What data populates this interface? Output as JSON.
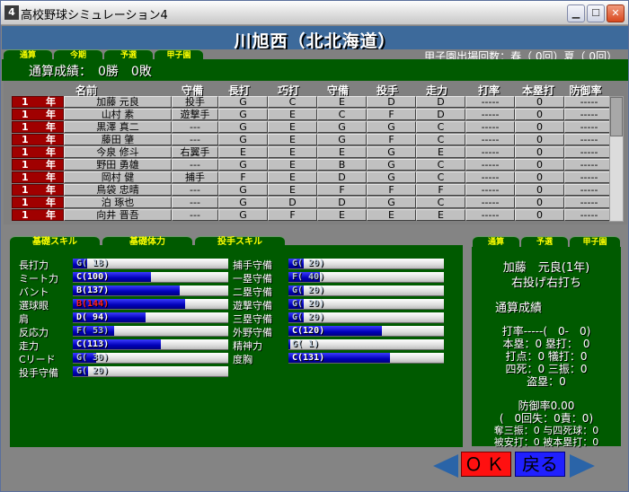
{
  "window": {
    "title": "高校野球シミュレーション4",
    "app_icon": "4",
    "buttons": {
      "minimize": "▁",
      "maximize": "☐",
      "close": "✕"
    }
  },
  "header": {
    "school_name": "川旭西（北北海道）",
    "appearances": "甲子園出場回数：春（ 0回）夏（ 0回）"
  },
  "top_tabs": [
    "通算",
    "今期",
    "予選",
    "甲子園"
  ],
  "record": {
    "label": "通算成績：　0勝　0敗"
  },
  "table": {
    "headers": [
      "名前",
      "守備",
      "長打",
      "巧打",
      "守備",
      "投手",
      "走力",
      "打率",
      "本塁打",
      "防御率"
    ],
    "rows": [
      {
        "grade_n": "1",
        "grade_y": "年",
        "name": "加藤 元良",
        "pos": "投手",
        "power": "G",
        "contact": "C",
        "field": "E",
        "pitch": "D",
        "speed": "D",
        "avg": "-----",
        "hr": "0",
        "era": "-----"
      },
      {
        "grade_n": "1",
        "grade_y": "年",
        "name": "山村 素",
        "pos": "遊撃手",
        "power": "G",
        "contact": "E",
        "field": "C",
        "pitch": "F",
        "speed": "D",
        "avg": "-----",
        "hr": "0",
        "era": "-----"
      },
      {
        "grade_n": "1",
        "grade_y": "年",
        "name": "黒澤 真二",
        "pos": "---",
        "power": "G",
        "contact": "E",
        "field": "G",
        "pitch": "G",
        "speed": "C",
        "avg": "-----",
        "hr": "0",
        "era": "-----"
      },
      {
        "grade_n": "1",
        "grade_y": "年",
        "name": "藤田 肇",
        "pos": "---",
        "power": "G",
        "contact": "E",
        "field": "G",
        "pitch": "F",
        "speed": "C",
        "avg": "-----",
        "hr": "0",
        "era": "-----"
      },
      {
        "grade_n": "1",
        "grade_y": "年",
        "name": "今泉 修斗",
        "pos": "右翼手",
        "power": "E",
        "contact": "E",
        "field": "E",
        "pitch": "G",
        "speed": "E",
        "avg": "-----",
        "hr": "0",
        "era": "-----"
      },
      {
        "grade_n": "1",
        "grade_y": "年",
        "name": "野田 勇雄",
        "pos": "---",
        "power": "G",
        "contact": "E",
        "field": "B",
        "pitch": "G",
        "speed": "C",
        "avg": "-----",
        "hr": "0",
        "era": "-----"
      },
      {
        "grade_n": "1",
        "grade_y": "年",
        "name": "岡村 健",
        "pos": "捕手",
        "power": "F",
        "contact": "E",
        "field": "D",
        "pitch": "G",
        "speed": "C",
        "avg": "-----",
        "hr": "0",
        "era": "-----"
      },
      {
        "grade_n": "1",
        "grade_y": "年",
        "name": "鳥袋 忠晴",
        "pos": "---",
        "power": "G",
        "contact": "E",
        "field": "F",
        "pitch": "F",
        "speed": "F",
        "avg": "-----",
        "hr": "0",
        "era": "-----"
      },
      {
        "grade_n": "1",
        "grade_y": "年",
        "name": "泊 琢也",
        "pos": "---",
        "power": "G",
        "contact": "D",
        "field": "D",
        "pitch": "G",
        "speed": "C",
        "avg": "-----",
        "hr": "0",
        "era": "-----"
      },
      {
        "grade_n": "1",
        "grade_y": "年",
        "name": "向井 晋吾",
        "pos": "---",
        "power": "G",
        "contact": "F",
        "field": "E",
        "pitch": "E",
        "speed": "E",
        "avg": "-----",
        "hr": "0",
        "era": "-----"
      }
    ]
  },
  "skill_tabs": [
    "基礎スキル",
    "基礎体力",
    "投手スキル"
  ],
  "skills_left": [
    {
      "label": "長打力",
      "text": "G( 18)",
      "value": 18,
      "style": "dim"
    },
    {
      "label": "ミート力",
      "text": "C(100)",
      "value": 100,
      "style": "normal"
    },
    {
      "label": "バント",
      "text": "B(137)",
      "value": 137,
      "style": "normal"
    },
    {
      "label": "選球眼",
      "text": "B(144)",
      "value": 144,
      "style": "red"
    },
    {
      "label": "肩",
      "text": "D( 94)",
      "value": 94,
      "style": "normal"
    },
    {
      "label": "反応力",
      "text": "F( 53)",
      "value": 53,
      "style": "dim"
    },
    {
      "label": "走力",
      "text": "C(113)",
      "value": 113,
      "style": "normal"
    },
    {
      "label": "Cリード",
      "text": "G( 30)",
      "value": 30,
      "style": "dim"
    },
    {
      "label": "投手守備",
      "text": "G( 20)",
      "value": 20,
      "style": "dim"
    }
  ],
  "skills_right": [
    {
      "label": "捕手守備",
      "text": "G( 20)",
      "value": 20,
      "style": "dim"
    },
    {
      "label": "一塁守備",
      "text": "F( 40)",
      "value": 40,
      "style": "dim"
    },
    {
      "label": "二塁守備",
      "text": "G( 20)",
      "value": 20,
      "style": "dim"
    },
    {
      "label": "遊撃守備",
      "text": "G( 20)",
      "value": 20,
      "style": "dim"
    },
    {
      "label": "三塁守備",
      "text": "G( 20)",
      "value": 20,
      "style": "dim"
    },
    {
      "label": "外野守備",
      "text": "C(120)",
      "value": 120,
      "style": "normal"
    },
    {
      "label": "精神力",
      "text": "G(  1)",
      "value": 1,
      "style": "dim"
    },
    {
      "label": "度胸",
      "text": "C(131)",
      "value": 131,
      "style": "normal"
    }
  ],
  "skill_max": 200,
  "info_tabs": [
    "通算",
    "予選",
    "甲子園"
  ],
  "info": {
    "player_name": "加藤　元良(1年)",
    "handedness": "右投げ右打ち",
    "section_title": "通算成績",
    "batting": [
      "打率-----(　0-　0)",
      "本塁：0 塁打：　0",
      "打点：0 犠打：0",
      "四死：0 三振：0",
      "盗塁：0"
    ],
    "pitching": [
      "防御率0.00",
      "(　0回失：0責：0)",
      "奪三振：0 与四死球：0",
      "被安打：0 被本塁打：0"
    ]
  },
  "buttons": {
    "ok": "ＯＫ",
    "back": "戻る"
  }
}
